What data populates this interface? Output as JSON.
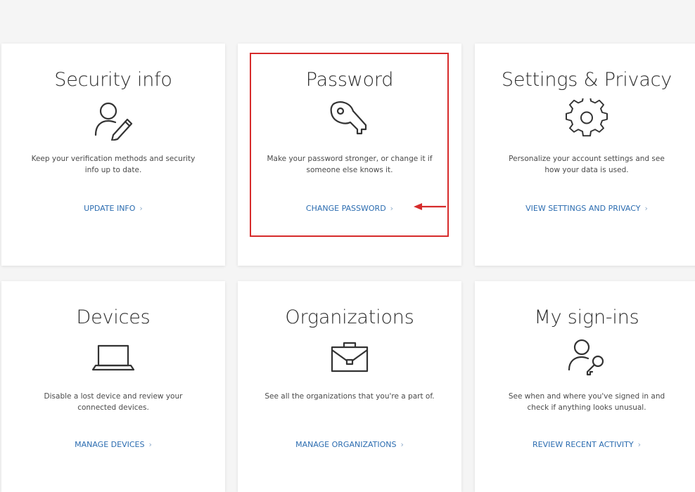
{
  "cards": [
    {
      "title": "Security info",
      "icon": "person-pen-icon",
      "description": "Keep your verification methods and security\ninfo up to date.",
      "link": "UPDATE INFO"
    },
    {
      "title": "Password",
      "icon": "key-icon",
      "description": "Make your password stronger, or change it if\nsomeone else knows it.",
      "link": "CHANGE PASSWORD"
    },
    {
      "title": "Settings & Privacy",
      "icon": "gear-icon",
      "description": "Personalize your account settings and see\nhow your data is used.",
      "link": "VIEW SETTINGS AND PRIVACY"
    },
    {
      "title": "Devices",
      "icon": "laptop-icon",
      "description": "Disable a lost device and review your\nconnected devices.",
      "link": "MANAGE DEVICES"
    },
    {
      "title": "Organizations",
      "icon": "briefcase-icon",
      "description": "See all the organizations that you're a part of.",
      "link": "MANAGE ORGANIZATIONS"
    },
    {
      "title": "My sign-ins",
      "icon": "person-key-icon",
      "description": "See when and where you've signed in and\ncheck if anything looks unusual.",
      "link": "REVIEW RECENT ACTIVITY"
    }
  ],
  "chevron": "›",
  "colors": {
    "link": "#2b6cb0",
    "highlight": "#d62b2b",
    "background": "#f5f5f5",
    "card": "#ffffff"
  }
}
